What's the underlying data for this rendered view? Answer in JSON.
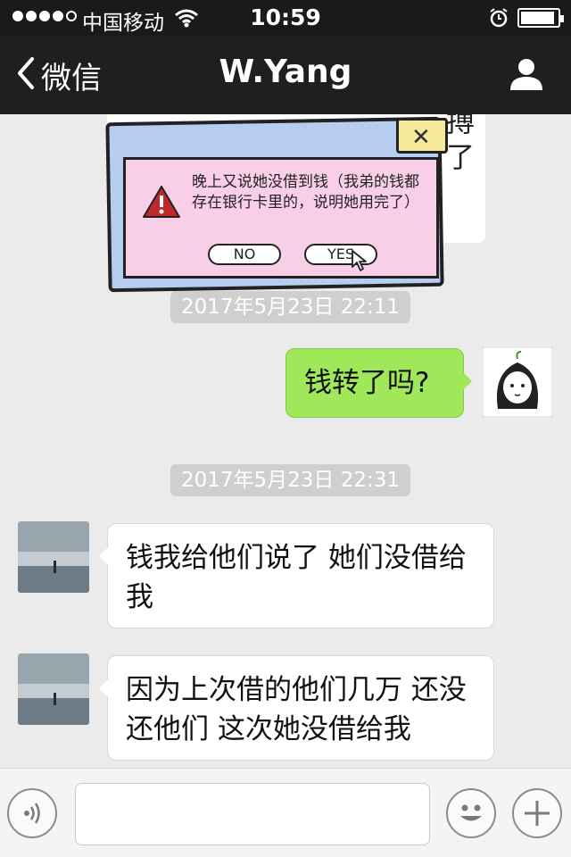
{
  "status_bar": {
    "carrier": "中国移动",
    "time": "10:59",
    "battery_level": 0.92,
    "signal_bars": 4
  },
  "nav": {
    "back_label": "微信",
    "title": "W.Yang"
  },
  "prev_message_fragment": "搏了",
  "meme": {
    "text": "晚上又说她没借到钱（我弟的钱都存在银行卡里的，说明她用完了）",
    "no_label": "NO",
    "yes_label": "YES",
    "close_glyph": "✕"
  },
  "messages": [
    {
      "type": "timestamp",
      "text": "2017年5月23日 22:11"
    },
    {
      "type": "outgoing",
      "text": "钱转了吗?"
    },
    {
      "type": "timestamp",
      "text": "2017年5月23日 22:31"
    },
    {
      "type": "incoming",
      "text": "钱我给他们说了 她们没借给我"
    },
    {
      "type": "incoming",
      "text": "因为上次借的他们几万 还没还他们 这次她没借给我"
    }
  ],
  "input_bar": {
    "placeholder": "",
    "value": ""
  },
  "colors": {
    "outgoing_bubble": "#a0e75a",
    "incoming_bubble": "#ffffff",
    "nav_background": "#1f1f1f",
    "chat_background": "#ebebeb"
  }
}
